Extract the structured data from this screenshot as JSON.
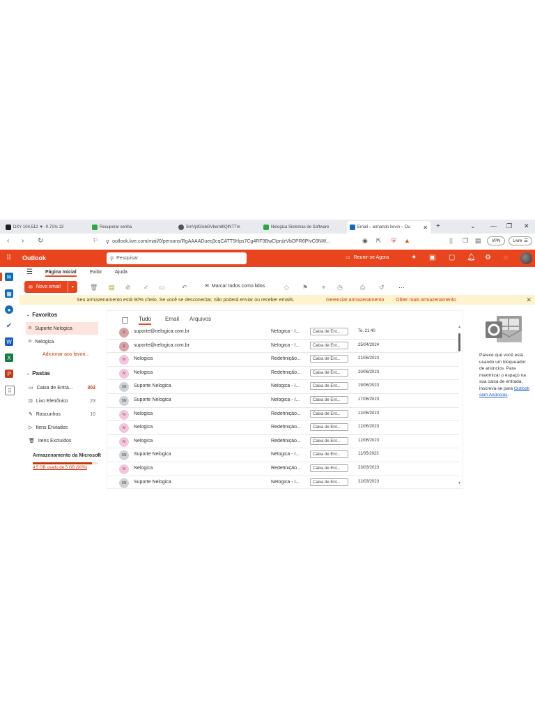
{
  "browser": {
    "tabs": [
      {
        "label": "DXY 104,512 ▼ -0.71% 13",
        "color": "#1f1f1f"
      },
      {
        "label": "Recuperar senha",
        "color": "#2ba84a"
      },
      {
        "label": "SmVjdGlsbGVkem9tQlNTTm",
        "color": "#555555"
      },
      {
        "label": "Nelogica Sistemas de Software",
        "color": "#2ba84a"
      },
      {
        "label": "Email – armando kevin – Ou",
        "color": "#0f6cbd"
      }
    ],
    "new_tab": "+",
    "url": "outlook.live.com/mail/0/persons/RgAAAADueq3cqCATT5Hps7Cg4RF3BwClprdzVbDPR6PIvC6NW...",
    "vpn_label": "VPN",
    "profile_label": "Livre"
  },
  "header": {
    "app_name": "Outlook",
    "search_placeholder": "Pesquisar",
    "meet_label": "Reunir-se Agora"
  },
  "ribbon": {
    "tabs": [
      "Página Inicial",
      "Exibir",
      "Ajuda"
    ],
    "new_email": "Novo email",
    "mark_all_read": "Marcar todos como lidos",
    "more": "···"
  },
  "banner": {
    "message": "Seu armazenamento está 90% cheio. Se você se desconectar, não poderá enviar ou receber emails.",
    "manage_link": "Gerenciar armazenamento",
    "more_link": "Obter mais armazenamento"
  },
  "folders": {
    "favorites_header": "Favoritos",
    "favorites": [
      {
        "label": "Suporte Nelogica"
      },
      {
        "label": "Nelogica"
      }
    ],
    "add_favorite": "Adicionar aos favori...",
    "folders_header": "Pastas",
    "items": [
      {
        "label": "Caixa de Entra...",
        "count": "303"
      },
      {
        "label": "Lixo Eletrônico",
        "count": "23"
      },
      {
        "label": "Rascunhos",
        "count": "10"
      },
      {
        "label": "Itens Enviados",
        "count": ""
      },
      {
        "label": "Itens Excluídos",
        "count": ""
      }
    ],
    "storage": {
      "title": "Armazenamento da Microsoft",
      "used_text": "4,5 GB usado de 5 GB (90%)",
      "fraction": 0.9
    }
  },
  "list": {
    "tabs": [
      "Tudo",
      "Email",
      "Arquivos"
    ],
    "rows": [
      {
        "avatar": "S",
        "kind": "s",
        "from": "suporte@nelogica.com.br",
        "subject": "Nelogica - I...",
        "folder": "Caixa de Ent...",
        "date": "Te, 21:40"
      },
      {
        "avatar": "S",
        "kind": "s",
        "from": "suporte@nelogica.com.br",
        "subject": "Nelogica - I...",
        "folder": "Caixa de Ent...",
        "date": "25/04/2024"
      },
      {
        "avatar": "N",
        "kind": "n",
        "from": "Nelogica",
        "subject": "Redefinição...",
        "folder": "Caixa de Ent...",
        "date": "21/06/2023"
      },
      {
        "avatar": "N",
        "kind": "n",
        "from": "Nelogica",
        "subject": "Redefinição...",
        "folder": "Caixa de Ent...",
        "date": "20/06/2023"
      },
      {
        "avatar": "SN",
        "kind": "sn",
        "from": "Suporte Nelogica",
        "subject": "Nelogica - I...",
        "folder": "Caixa de Ent...",
        "date": "19/06/2023"
      },
      {
        "avatar": "SN",
        "kind": "sn",
        "from": "Suporte Nelogica",
        "subject": "Nelogica - I...",
        "folder": "Caixa de Ent...",
        "date": "17/06/2023"
      },
      {
        "avatar": "N",
        "kind": "n",
        "from": "Nelogica",
        "subject": "Redefinição...",
        "folder": "Caixa de Ent...",
        "date": "12/06/2023"
      },
      {
        "avatar": "N",
        "kind": "n",
        "from": "Nelogica",
        "subject": "Redefinição...",
        "folder": "Caixa de Ent...",
        "date": "12/06/2023"
      },
      {
        "avatar": "N",
        "kind": "n",
        "from": "Nelogica",
        "subject": "Redefinição...",
        "folder": "Caixa de Ent...",
        "date": "12/06/2023"
      },
      {
        "avatar": "SN",
        "kind": "sn",
        "from": "Suporte Nelogica",
        "subject": "Nelogica - I...",
        "folder": "Caixa de Ent...",
        "date": "11/05/2023"
      },
      {
        "avatar": "N",
        "kind": "n",
        "from": "Nelogica",
        "subject": "Redefinição...",
        "folder": "Caixa de Ent...",
        "date": "23/03/2023"
      },
      {
        "avatar": "SN",
        "kind": "sn",
        "from": "Suporte Nelogica",
        "subject": "Nelogica - I...",
        "folder": "Caixa de Ent...",
        "date": "22/03/2023"
      }
    ]
  },
  "ad": {
    "text": "Parece que você está usando um bloqueador de anúncios. Para maximizar o espaço na sua caixa de entrada, inscreva-se para",
    "link": "Outlook sem Anúncios",
    "end": "."
  },
  "colors": {
    "accent": "#e8451f",
    "link": "#c4380b"
  }
}
